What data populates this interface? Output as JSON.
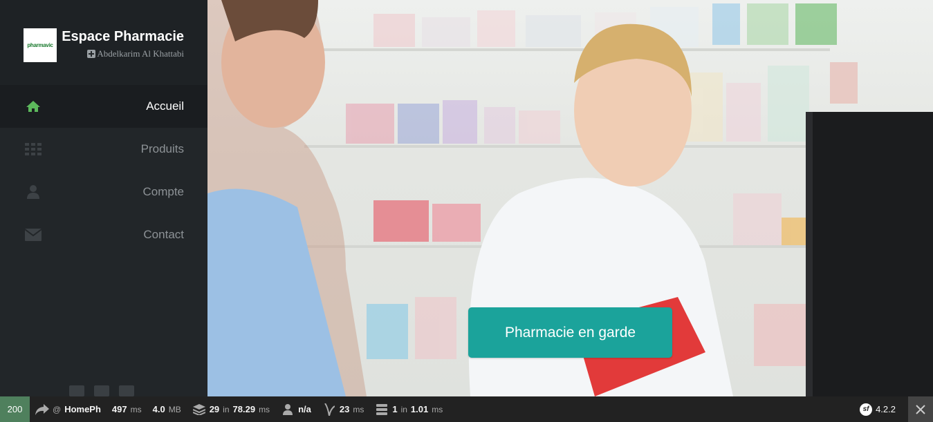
{
  "brand": {
    "logo_text": "pharmavic",
    "title": "Espace Pharmacie",
    "user": "Abdelkarim Al Khattabi"
  },
  "nav": {
    "items": [
      {
        "label": "Accueil",
        "icon": "home-icon",
        "active": true
      },
      {
        "label": "Produits",
        "icon": "grid-icon",
        "active": false
      },
      {
        "label": "Compte",
        "icon": "user-icon",
        "active": false
      },
      {
        "label": "Contact",
        "icon": "envelope-icon",
        "active": false
      }
    ]
  },
  "hero": {
    "cta_label": "Pharmacie en garde"
  },
  "toolbar": {
    "status_code": "200",
    "route_at": "@",
    "route": "HomePh",
    "time_value": "497",
    "time_unit": "ms",
    "memory_value": "4.0",
    "memory_unit": "MB",
    "forms_count": "29",
    "forms_in": "in",
    "forms_time": "78.29",
    "forms_unit": "ms",
    "user": "n/a",
    "twig_value": "23",
    "twig_unit": "ms",
    "db_count": "1",
    "db_in": "in",
    "db_time": "1.01",
    "db_unit": "ms",
    "version": "4.2.2",
    "sf_logo": "sf"
  },
  "colors": {
    "sidebar_bg": "#222629",
    "accent_green": "#5cb85c",
    "cta_bg": "#1ba39b",
    "status_bg": "#4f805d"
  }
}
